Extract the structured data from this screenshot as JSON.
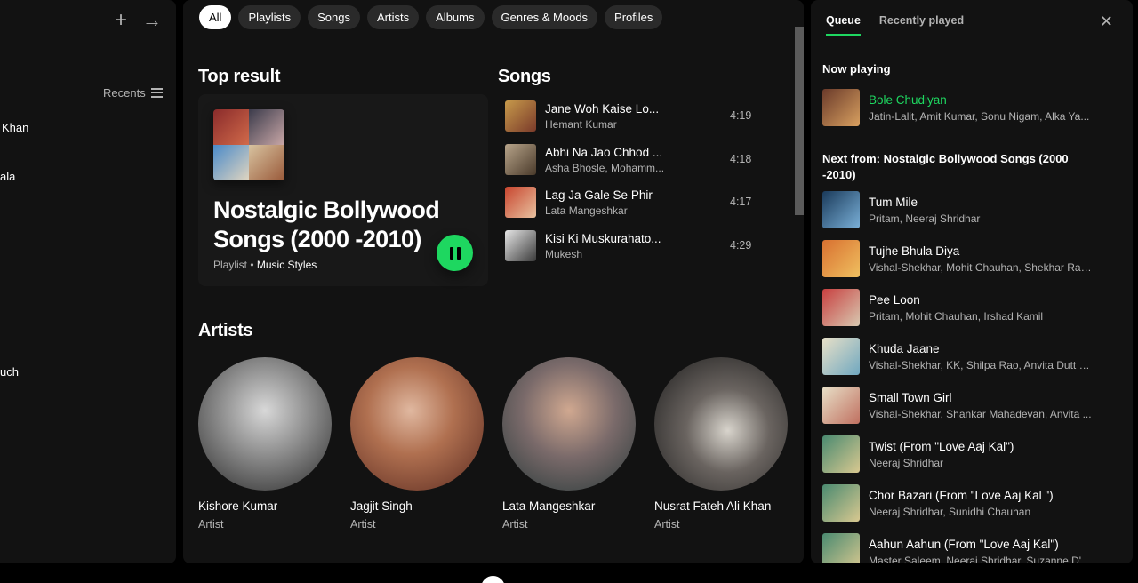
{
  "left": {
    "recents_label": "Recents",
    "items": [
      "Khan",
      "ala",
      "uch"
    ]
  },
  "filters": [
    "All",
    "Playlists",
    "Songs",
    "Artists",
    "Albums",
    "Genres & Moods",
    "Profiles"
  ],
  "top_result": {
    "heading": "Top result",
    "title": "Nostalgic Bollywood Songs (2000 -2010)",
    "type": "Playlist",
    "owner": "Music Styles"
  },
  "songs": {
    "heading": "Songs",
    "items": [
      {
        "title": "Jane Woh Kaise Lo...",
        "artist": "Hemant Kumar",
        "duration": "4:19"
      },
      {
        "title": "Abhi Na Jao Chhod ...",
        "artist": "Asha Bhosle, Mohamm...",
        "duration": "4:18"
      },
      {
        "title": "Lag Ja Gale Se Phir",
        "artist": "Lata Mangeshkar",
        "duration": "4:17"
      },
      {
        "title": "Kisi Ki Muskurahato...",
        "artist": "Mukesh",
        "duration": "4:29"
      }
    ]
  },
  "artists": {
    "heading": "Artists",
    "items": [
      {
        "name": "Kishore Kumar",
        "type": "Artist"
      },
      {
        "name": "Jagjit Singh",
        "type": "Artist"
      },
      {
        "name": "Lata Mangeshkar",
        "type": "Artist"
      },
      {
        "name": "Nusrat Fateh Ali Khan",
        "type": "Artist"
      }
    ]
  },
  "queue": {
    "tabs": [
      "Queue",
      "Recently played"
    ],
    "now_playing_label": "Now playing",
    "now_playing": {
      "title": "Bole Chudiyan",
      "artist": "Jatin-Lalit, Amit Kumar, Sonu Nigam, Alka Ya..."
    },
    "next_from_label": "Next from: Nostalgic Bollywood Songs (2000 -2010)",
    "items": [
      {
        "title": "Tum Mile",
        "artist": "Pritam, Neeraj Shridhar"
      },
      {
        "title": "Tujhe Bhula Diya",
        "artist": "Vishal-Shekhar, Mohit Chauhan, Shekhar Rav..."
      },
      {
        "title": "Pee Loon",
        "artist": "Pritam, Mohit Chauhan, Irshad Kamil"
      },
      {
        "title": "Khuda Jaane",
        "artist": "Vishal-Shekhar, KK, Shilpa Rao, Anvita Dutt G..."
      },
      {
        "title": "Small Town Girl",
        "artist": "Vishal-Shekhar, Shankar Mahadevan, Anvita ..."
      },
      {
        "title": "Twist (From \"Love Aaj Kal\")",
        "artist": "Neeraj Shridhar"
      },
      {
        "title": "Chor Bazari (From \"Love Aaj Kal \")",
        "artist": "Neeraj Shridhar, Sunidhi Chauhan"
      },
      {
        "title": "Aahun Aahun (From \"Love Aaj Kal\")",
        "artist": "Master Saleem, Neeraj Shridhar, Suzanne D'..."
      }
    ]
  },
  "colors": {
    "accent": "#1ed760",
    "panel_bg": "#121212",
    "card_bg": "#181818",
    "chip_bg": "#2a2a2a",
    "muted_text": "#b3b3b3"
  },
  "icons": [
    "plus-icon",
    "arrow-right-icon",
    "list-icon",
    "pause-icon",
    "close-icon"
  ]
}
